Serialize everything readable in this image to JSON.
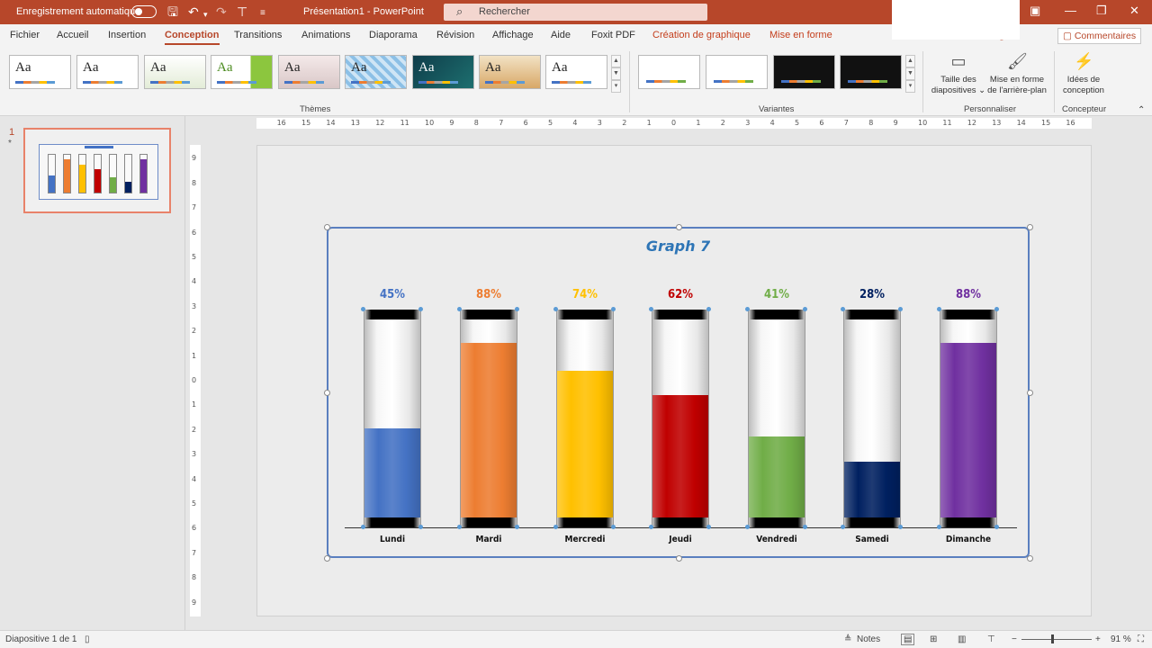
{
  "titlebar": {
    "autosave_label": "Enregistrement automatique",
    "document_title": "Présentation1 - PowerPoint",
    "search_placeholder": "Rechercher"
  },
  "tabs": [
    "Fichier",
    "Accueil",
    "Insertion",
    "Conception",
    "Transitions",
    "Animations",
    "Diaporama",
    "Révision",
    "Affichage",
    "Aide",
    "Foxit PDF",
    "Création de graphique",
    "Mise en forme"
  ],
  "active_tab": "Conception",
  "share_label": "tager",
  "comments_label": "Commentaires",
  "ribbon": {
    "themes_group": "Thèmes",
    "theme_sample": "Aa",
    "variants_group": "Variantes",
    "customize_group": "Personnaliser",
    "designer_group": "Concepteur",
    "slide_size_label": [
      "Taille des",
      "diapositives ⌄"
    ],
    "format_bg_label": [
      "Mise en forme",
      "de l'arrière-plan"
    ],
    "design_ideas_label": [
      "Idées de",
      "conception"
    ]
  },
  "slide_panel": {
    "slide_number": "1",
    "star": "*"
  },
  "chart_data": {
    "type": "bar",
    "title": "Graph 7",
    "categories": [
      "Lundi",
      "Mardi",
      "Mercredi",
      "Jeudi",
      "Vendredi",
      "Samedi",
      "Dimanche"
    ],
    "values": [
      45,
      88,
      74,
      62,
      41,
      28,
      88
    ],
    "value_labels": [
      "45%",
      "88%",
      "74%",
      "62%",
      "41%",
      "28%",
      "88%"
    ],
    "colors": [
      "#4472c4",
      "#ed7d31",
      "#ffc000",
      "#c00000",
      "#70ad47",
      "#002060",
      "#7030a0"
    ],
    "ylim": [
      0,
      100
    ],
    "style": "test-tube"
  },
  "statusbar": {
    "slide_info": "Diapositive 1 de 1",
    "notes_label": "Notes",
    "zoom": "91 %"
  }
}
